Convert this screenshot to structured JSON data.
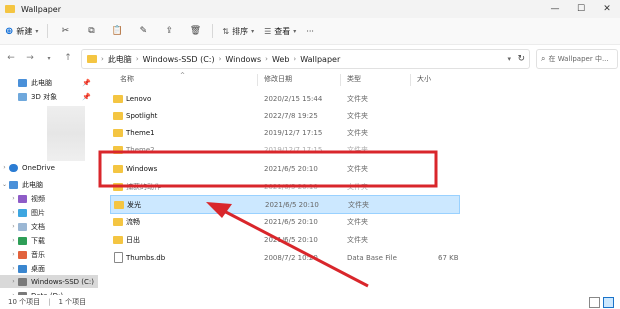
{
  "window": {
    "title": "Wallpaper"
  },
  "toolbar": {
    "new_label": "新建",
    "sort_label": "排序",
    "view_label": "查看",
    "more_label": "···"
  },
  "address": {
    "crumbs": [
      "此电脑",
      "Windows-SSD (C:)",
      "Windows",
      "Web",
      "Wallpaper"
    ],
    "search_placeholder": "在 Wallpaper 中..."
  },
  "sidebar": {
    "items": [
      {
        "label": "此电脑",
        "icon": "computer-icon",
        "pinned": true
      },
      {
        "label": "3D 对象",
        "icon": "3d-objects-icon",
        "pinned": true
      },
      {
        "label": "OneDrive",
        "icon": "cloud-icon",
        "pinned": false
      },
      {
        "label": "此电脑",
        "icon": "computer-icon",
        "pinned": false
      },
      {
        "label": "视频",
        "icon": "video-icon",
        "pinned": false
      },
      {
        "label": "图片",
        "icon": "picture-icon",
        "pinned": false
      },
      {
        "label": "文档",
        "icon": "document-icon",
        "pinned": false
      },
      {
        "label": "下载",
        "icon": "download-icon",
        "pinned": false
      },
      {
        "label": "音乐",
        "icon": "music-icon",
        "pinned": false
      },
      {
        "label": "桌面",
        "icon": "desktop-icon",
        "pinned": false
      },
      {
        "label": "Windows-SSD (C:)",
        "icon": "drive-icon",
        "pinned": false
      },
      {
        "label": "Data (D:)",
        "icon": "drive-icon",
        "pinned": false
      }
    ]
  },
  "columns": {
    "name": "名称",
    "date": "修改日期",
    "type": "类型",
    "size": "大小"
  },
  "files": [
    {
      "name": "Lenovo",
      "date": "2020/2/15 15:44",
      "type": "文件夹",
      "size": ""
    },
    {
      "name": "Spotlight",
      "date": "2022/7/8 19:25",
      "type": "文件夹",
      "size": ""
    },
    {
      "name": "Theme1",
      "date": "2019/12/7 17:15",
      "type": "文件夹",
      "size": ""
    },
    {
      "name": "Theme2",
      "date": "2019/12/7 17:15",
      "type": "文件夹",
      "size": ""
    },
    {
      "name": "Windows",
      "date": "2021/6/5 20:10",
      "type": "文件夹",
      "size": ""
    },
    {
      "name": "捕获的动作",
      "date": "2021/6/5 20:10",
      "type": "文件夹",
      "size": ""
    },
    {
      "name": "发光",
      "date": "2021/6/5 20:10",
      "type": "文件夹",
      "size": ""
    },
    {
      "name": "流畅",
      "date": "2021/6/5 20:10",
      "type": "文件夹",
      "size": ""
    },
    {
      "name": "日出",
      "date": "2021/6/5 20:10",
      "type": "文件夹",
      "size": ""
    },
    {
      "name": "Thumbs.db",
      "date": "2008/7/2 10:20",
      "type": "Data Base File",
      "size": "67 KB"
    }
  ],
  "status": {
    "items_count": "10 个项目",
    "selected_count": "1 个项目"
  },
  "colors": {
    "selection": "#cce8ff",
    "annotation": "#d9262b",
    "folder": "#f4c542"
  }
}
